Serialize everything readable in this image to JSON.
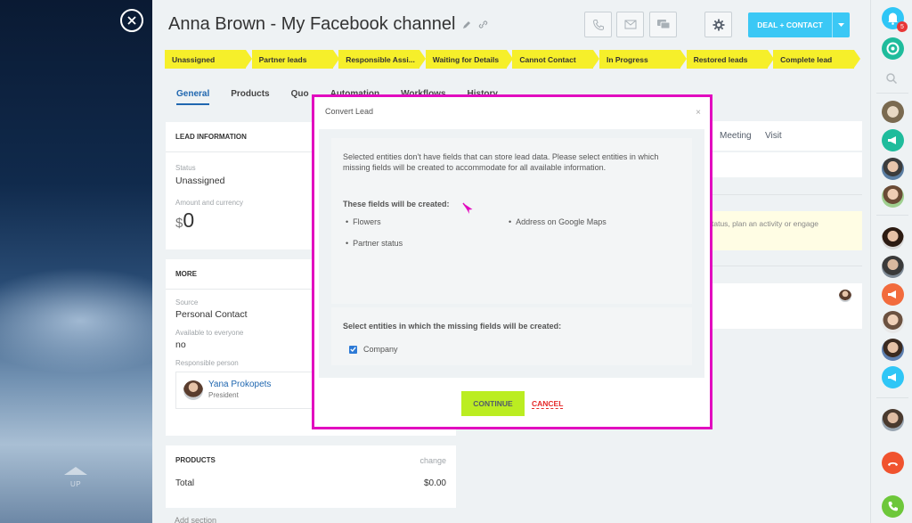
{
  "left_panel": {
    "up_label": "UP"
  },
  "header": {
    "title": "Anna Brown - My Facebook channel",
    "deal_contact_label": "DEAL + CONTACT"
  },
  "stages": [
    "Unassigned",
    "Partner leads",
    "Responsible Assi...",
    "Waiting for Details",
    "Cannot Contact",
    "In Progress",
    "Restored leads",
    "Complete lead"
  ],
  "stage_color": "#f6ef2a",
  "tabs": [
    "General",
    "Products",
    "Quo",
    "Automation",
    "Workflows",
    "History"
  ],
  "lead_info": {
    "heading": "LEAD INFORMATION",
    "status_label": "Status",
    "status_value": "Unassigned",
    "amount_label": "Amount and currency",
    "currency_symbol": "$",
    "amount_value": "0"
  },
  "more": {
    "heading": "MORE",
    "source_label": "Source",
    "source_value": "Personal Contact",
    "available_label": "Available to everyone",
    "available_value": "no",
    "responsible_label": "Responsible person",
    "responsible_name": "Yana Prokopets",
    "responsible_role": "President"
  },
  "products": {
    "heading": "PRODUCTS",
    "change_label": "change",
    "total_label": "Total",
    "total_value": "$0.00",
    "add_section": "Add section"
  },
  "activity": {
    "tab_meeting": "Meeting",
    "tab_visit": "Visit",
    "hint": "tatus, plan an activity or engage"
  },
  "right_panel": {
    "notification_count": "5"
  },
  "modal": {
    "title": "Convert Lead",
    "close": "×",
    "message": "Selected entities don't have fields that can store lead data. Please select entities in which missing fields will be created to accommodate for all available information.",
    "fields_header": "These fields will be created:",
    "fields": [
      "Flowers",
      "Partner status",
      "Address on Google Maps"
    ],
    "entities_header": "Select entities in which the missing fields will be created:",
    "entity_option": "Company",
    "entity_checked": true,
    "continue_label": "CONTINUE",
    "cancel_label": "CANCEL"
  },
  "colors": {
    "accent_blue": "#3bc8f5",
    "continue_green": "#bbed21",
    "cancel_red": "#e52929",
    "highlight_magenta": "#e20bbf"
  }
}
